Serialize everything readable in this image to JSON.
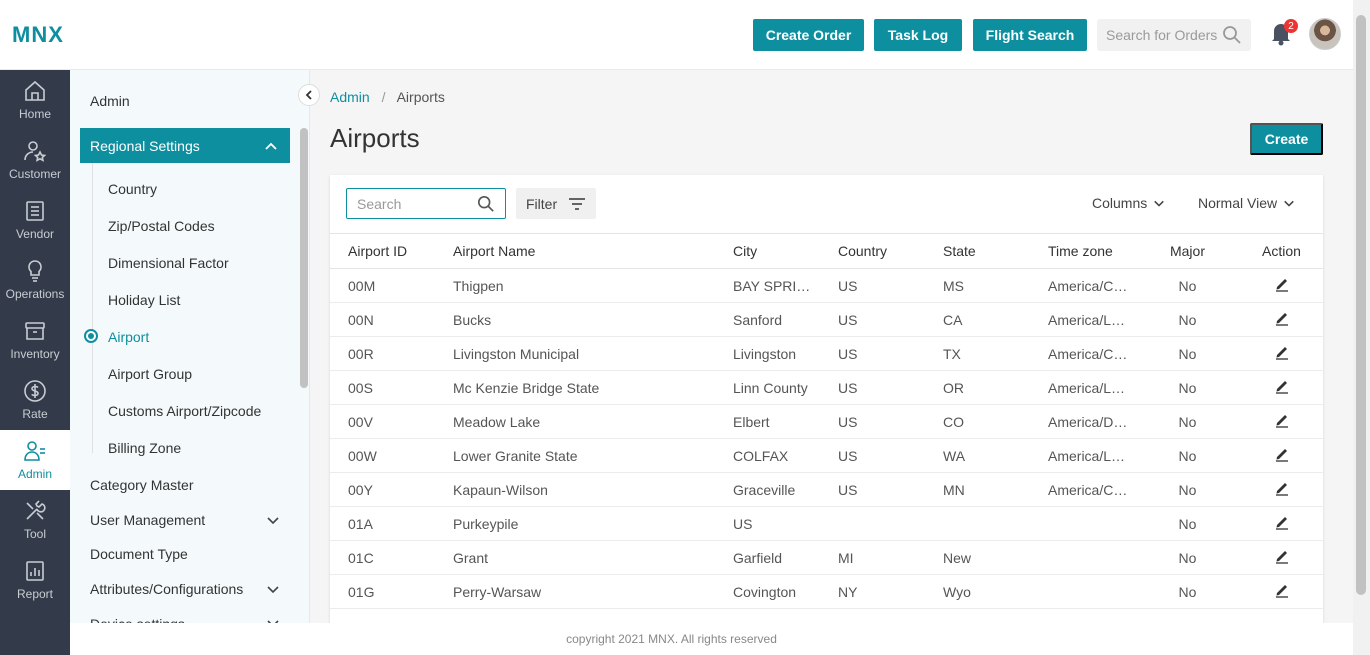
{
  "brand": {
    "logo": "MNX",
    "accent": "#0e8fa0",
    "nav_bg": "#333b4a"
  },
  "topbar": {
    "create_order": "Create Order",
    "task_log": "Task Log",
    "flight_search": "Flight Search",
    "search_placeholder": "Search for Orders",
    "notification_count": "2"
  },
  "leftnav": [
    {
      "label": "Home",
      "icon": "home-icon"
    },
    {
      "label": "Customer",
      "icon": "customer-icon"
    },
    {
      "label": "Vendor",
      "icon": "vendor-icon"
    },
    {
      "label": "Operations",
      "icon": "operations-icon"
    },
    {
      "label": "Inventory",
      "icon": "inventory-icon"
    },
    {
      "label": "Rate",
      "icon": "rate-icon"
    },
    {
      "label": "Admin",
      "icon": "admin-icon",
      "active": true
    },
    {
      "label": "Tool",
      "icon": "tool-icon"
    },
    {
      "label": "Report",
      "icon": "report-icon"
    }
  ],
  "submenu": {
    "heading": "Admin",
    "regional_settings": "Regional Settings",
    "regional_items": [
      "Country",
      "Zip/Postal Codes",
      "Dimensional Factor",
      "Holiday List",
      "Airport",
      "Airport Group",
      "Customs Airport/Zipcode",
      "Billing Zone"
    ],
    "other_items": [
      "Category Master",
      "User Management",
      "Document Type",
      "Attributes/Configurations",
      "Device settings"
    ]
  },
  "breadcrumb": {
    "root": "Admin",
    "separator": "/",
    "current": "Airports"
  },
  "page": {
    "title": "Airports",
    "create": "Create"
  },
  "toolbar": {
    "search_placeholder": "Search",
    "filter": "Filter",
    "columns": "Columns",
    "view": "Normal View"
  },
  "table": {
    "headers": [
      "Airport ID",
      "Airport Name",
      "City",
      "Country",
      "State",
      "Time zone",
      "Major",
      "Action"
    ],
    "rows": [
      [
        "00M",
        "Thigpen",
        "BAY SPRIN…",
        "US",
        "MS",
        "America/C…",
        "No"
      ],
      [
        "00N",
        "Bucks",
        "Sanford",
        "US",
        "CA",
        "America/L…",
        "No"
      ],
      [
        "00R",
        "Livingston Municipal",
        "Livingston",
        "US",
        "TX",
        "America/C…",
        "No"
      ],
      [
        "00S",
        "Mc Kenzie Bridge State",
        "Linn County",
        "US",
        "OR",
        "America/L…",
        "No"
      ],
      [
        "00V",
        "Meadow Lake",
        "Elbert",
        "US",
        "CO",
        "America/D…",
        "No"
      ],
      [
        "00W",
        "Lower Granite State",
        "COLFAX",
        "US",
        "WA",
        "America/L…",
        "No"
      ],
      [
        "00Y",
        "Kapaun-Wilson",
        "Graceville",
        "US",
        "MN",
        "America/C…",
        "No"
      ],
      [
        "01A",
        "Purkeypile",
        "US",
        "",
        "",
        "",
        "No"
      ],
      [
        "01C",
        "Grant",
        "Garfield",
        "MI",
        "New",
        "",
        "No"
      ],
      [
        "01G",
        "Perry-Warsaw",
        "Covington",
        "NY",
        "Wyo",
        "",
        "No"
      ]
    ]
  },
  "footer": "copyright 2021 MNX. All rights reserved"
}
